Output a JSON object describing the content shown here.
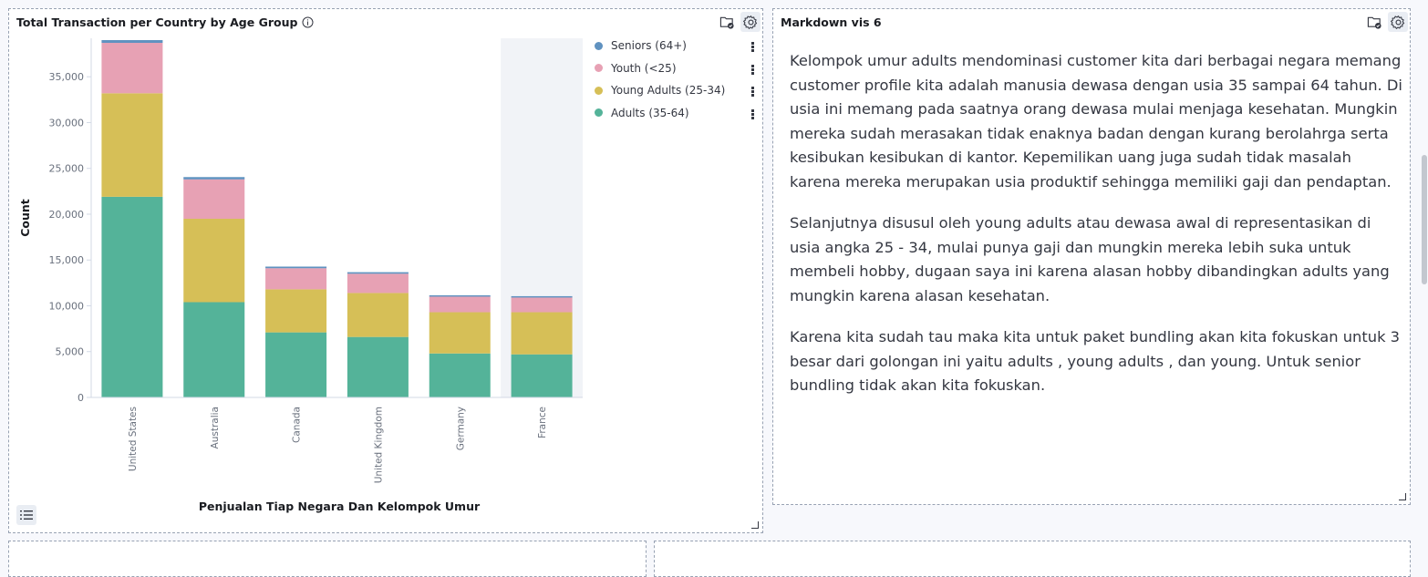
{
  "panels": {
    "chart_panel": {
      "title": "Total Transaction per Country by Age Group"
    },
    "markdown_panel": {
      "title": "Markdown vis 6",
      "paragraphs": [
        "Kelompok umur adults mendominasi customer kita dari berbagai negara memang customer profile kita adalah manusia dewasa dengan usia 35 sampai 64 tahun. Di usia ini memang pada saatnya orang dewasa mulai menjaga kesehatan. Mungkin mereka sudah merasakan tidak enaknya badan dengan kurang berolahrga serta kesibukan kesibukan di kantor. Kepemilikan uang juga sudah tidak masalah karena mereka merupakan usia produktif sehingga memiliki gaji dan pendaptan.",
        "Selanjutnya disusul oleh young adults atau dewasa awal di representasikan di usia angka 25 - 34, mulai punya gaji dan mungkin mereka lebih suka untuk membeli hobby, dugaan saya ini karena alasan hobby dibandingkan adults yang mungkin karena alasan kesehatan.",
        "Karena kita sudah tau maka kita untuk paket bundling akan kita fokuskan untuk 3 besar dari golongan ini yaitu adults , young adults , dan young. Untuk senior bundling tidak akan kita fokuskan."
      ]
    }
  },
  "icons": {
    "info": "info-icon",
    "inspect": "inspect-folder-icon",
    "settings": "gear-icon",
    "legend_toggle": "list-icon"
  },
  "chart_data": {
    "type": "bar",
    "stacked": true,
    "title": "",
    "xlabel": "Penjualan Tiap Negara Dan Kelompok Umur",
    "ylabel": "Count",
    "categories": [
      "United States",
      "Australia",
      "Canada",
      "United Kingdom",
      "Germany",
      "France"
    ],
    "series": [
      {
        "name": "Adults (35-64)",
        "color": "#54b399",
        "values": [
          21900,
          10400,
          7100,
          6600,
          4800,
          4700
        ]
      },
      {
        "name": "Young Adults (25-34)",
        "color": "#d6bf57",
        "values": [
          11300,
          9100,
          4700,
          4800,
          4500,
          4600
        ]
      },
      {
        "name": "Youth (<25)",
        "color": "#e7a1b4",
        "values": [
          5500,
          4300,
          2300,
          2100,
          1700,
          1600
        ]
      },
      {
        "name": "Seniors (64+)",
        "color": "#6092c0",
        "values": [
          300,
          250,
          180,
          170,
          150,
          150
        ]
      }
    ],
    "yticks": [
      "0",
      "5,000",
      "10,000",
      "15,000",
      "20,000",
      "25,000",
      "30,000",
      "35,000"
    ],
    "ylim": [
      0,
      39200
    ],
    "grid": false,
    "legend_position": "right",
    "legend_order": [
      "Seniors (64+)",
      "Youth (<25)",
      "Young Adults (25-34)",
      "Adults (35-64)"
    ],
    "highlighted_category": "France"
  }
}
